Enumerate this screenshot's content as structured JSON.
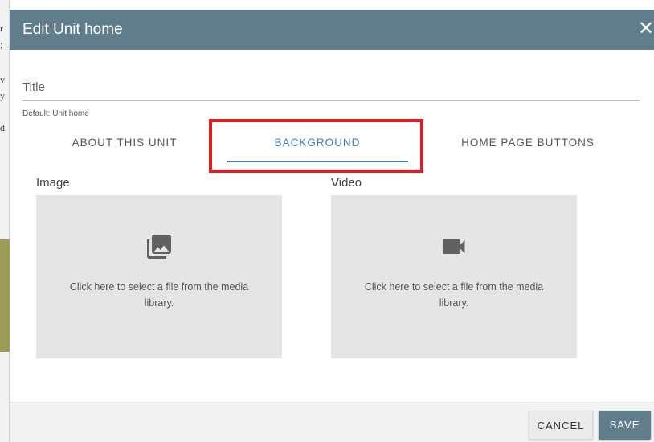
{
  "background_page": {
    "chars": [
      "r",
      ";",
      "v",
      "y",
      "d"
    ]
  },
  "dialog": {
    "title": "Edit Unit home",
    "close_symbol": "✕"
  },
  "form": {
    "title_label": "Title",
    "title_hint": "Default: Unit home"
  },
  "tabs": [
    {
      "label": "ABOUT THIS UNIT",
      "active": false
    },
    {
      "label": "BACKGROUND",
      "active": true
    },
    {
      "label": "HOME PAGE BUTTONS",
      "active": false
    }
  ],
  "media": {
    "image": {
      "label": "Image",
      "icon": "photo-library-icon",
      "text": "Click here to select a file from the media library."
    },
    "video": {
      "label": "Video",
      "icon": "videocam-icon",
      "text": "Click here to select a file from the media library."
    }
  },
  "footer": {
    "cancel_label": "CANCEL",
    "save_label": "SAVE"
  },
  "colors": {
    "header": "#607d8b",
    "accent": "#3f7fb8",
    "highlight": "#e01b22",
    "dropzone": "#e5e5e5",
    "icon": "#616161"
  }
}
